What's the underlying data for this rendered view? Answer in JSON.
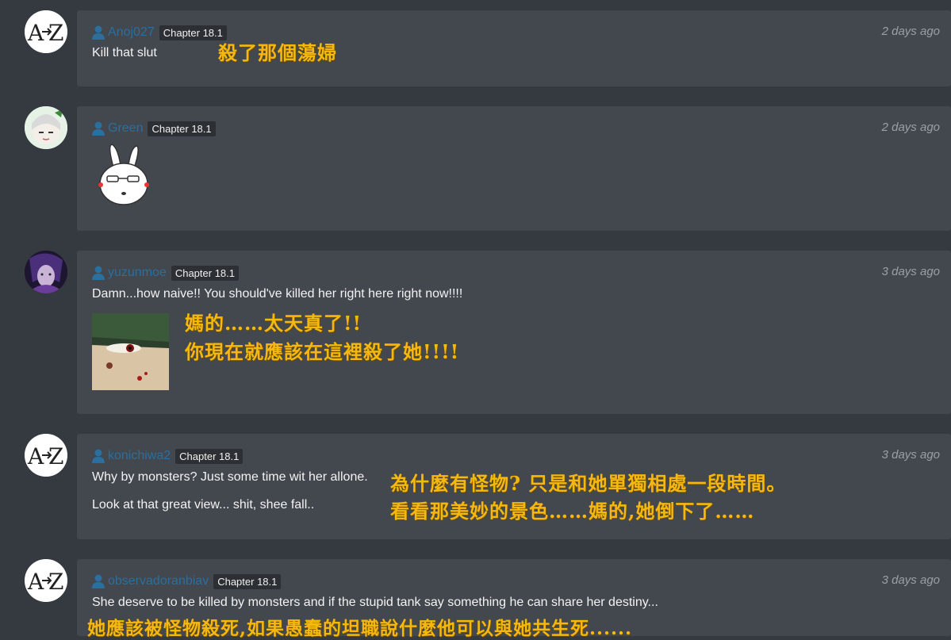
{
  "comments": [
    {
      "username": "Anoj027",
      "chapter": "Chapter 18.1",
      "time": "2 days ago",
      "text": "Kill that slut",
      "translation": "殺了那個蕩婦",
      "avatar": "a-to-z-logo"
    },
    {
      "username": "Green",
      "chapter": "Chapter 18.1",
      "time": "2 days ago",
      "text": "",
      "sticker": "white-rabbit-sticker",
      "avatar": "anime-girl-avatar"
    },
    {
      "username": "yuzunmoe",
      "chapter": "Chapter 18.1",
      "time": "3 days ago",
      "text": "Damn...how naive!! You should've killed her right here right now!!!!",
      "translation_line1": "媽的……太天真了!!",
      "translation_line2": "你現在就應該在這裡殺了她!!!!",
      "image": "meme-face-image",
      "avatar": "dark-character-avatar"
    },
    {
      "username": "konichiwa2",
      "chapter": "Chapter 18.1",
      "time": "3 days ago",
      "text_line1": "Why by monsters? Just some time wit her allone.",
      "text_line2": "Look at that great view... shit, shee fall..",
      "translation_line1": "為什麼有怪物? 只是和她單獨相處一段時間。",
      "translation_line2": "看看那美妙的景色……媽的,她倒下了……",
      "avatar": "a-to-z-logo"
    },
    {
      "username": "observadoranbiav",
      "chapter": "Chapter 18.1",
      "time": "3 days ago",
      "text": "She deserve to be killed by monsters and if the stupid tank say something he can share her destiny...",
      "translation": "她應該被怪物殺死,如果愚蠢的坦職說什麼他可以與她共生死......",
      "avatar": "a-to-z-logo"
    }
  ],
  "colors": {
    "background": "#353940",
    "card": "#43474e",
    "username": "#2a6f9e",
    "translation": "#f5b80f"
  }
}
